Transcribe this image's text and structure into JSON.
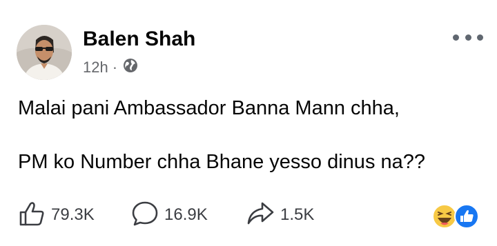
{
  "post": {
    "author": "Balen Shah",
    "time": "12h",
    "separator": "·",
    "audience_icon": "globe-icon",
    "more_icon": "more-dots-icon",
    "paragraphs": [
      "Malai pani Ambassador Banna Mann chha,",
      "PM ko Number chha Bhane yesso dinus na??"
    ]
  },
  "actions": {
    "like": {
      "icon": "like-thumb-icon",
      "count": "79.3K"
    },
    "comment": {
      "icon": "comment-bubble-icon",
      "count": "16.9K"
    },
    "share": {
      "icon": "share-arrow-icon",
      "count": "1.5K"
    },
    "reactions": [
      "haha-emoji-icon",
      "like-reaction-icon"
    ]
  },
  "colors": {
    "meta_text": "#65676b",
    "reaction_blue": "#1877f2",
    "haha_yellow": "#f7c945"
  }
}
